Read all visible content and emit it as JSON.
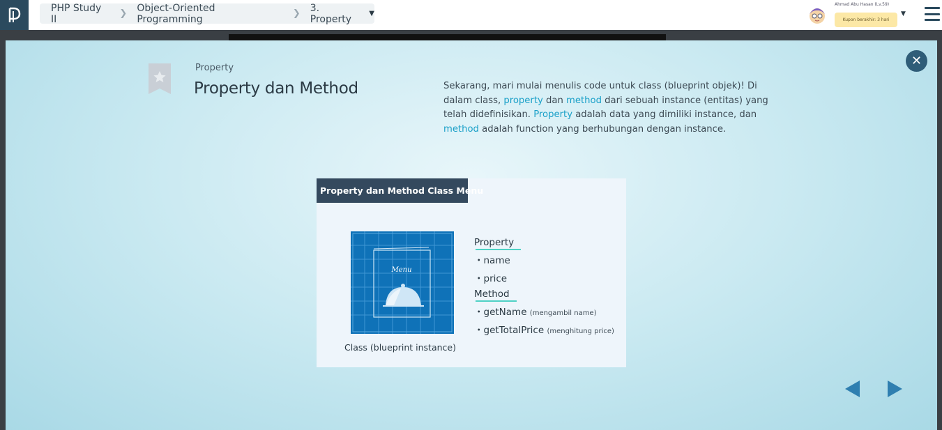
{
  "header": {
    "breadcrumbs": [
      "PHP Study II",
      "Object-Oriented Programming",
      "3. Property"
    ],
    "user_name": "Ahmad Abu Hasan (Lv.59)",
    "coupon_text": "Kupon berakhir: 3 hari"
  },
  "slide": {
    "subtitle": "Property",
    "title": "Property dan Method",
    "desc": [
      {
        "t": "Sekarang, mari mulai menulis code untuk class (blueprint objek)! Di dalam class, ",
        "hl": false
      },
      {
        "t": "property",
        "hl": true
      },
      {
        "t": " dan ",
        "hl": false
      },
      {
        "t": "method",
        "hl": true
      },
      {
        "t": " dari sebuah instance (entitas) yang telah didefinisikan. ",
        "hl": false
      },
      {
        "t": "Property",
        "hl": true
      },
      {
        "t": " adalah data yang dimiliki instance, dan ",
        "hl": false
      },
      {
        "t": "method",
        "hl": true
      },
      {
        "t": " adalah function yang berhubungan dengan instance.",
        "hl": false
      }
    ],
    "card": {
      "header": "Property dan Method Class Menu",
      "menu_label": "Menu",
      "caption": "Class (blueprint instance)",
      "property_heading": "Property",
      "properties": [
        "・name",
        "・price"
      ],
      "method_heading": "Method",
      "methods": [
        {
          "name": "・getName",
          "note": "(mengambil name)"
        },
        {
          "name": "・getTotalPrice",
          "note": "(menghitung price)"
        }
      ]
    }
  },
  "icons": {
    "close": "close-icon",
    "bookmark": "bookmark-star-icon",
    "prev": "arrow-left-icon",
    "next": "arrow-right-icon",
    "menu": "hamburger-menu-icon"
  },
  "colors": {
    "accent": "#1aa0c8",
    "nav_dark": "#2b4a5e",
    "card_header": "#34495e",
    "blueprint": "#0f72b8",
    "underline": "#4fd1c5"
  }
}
